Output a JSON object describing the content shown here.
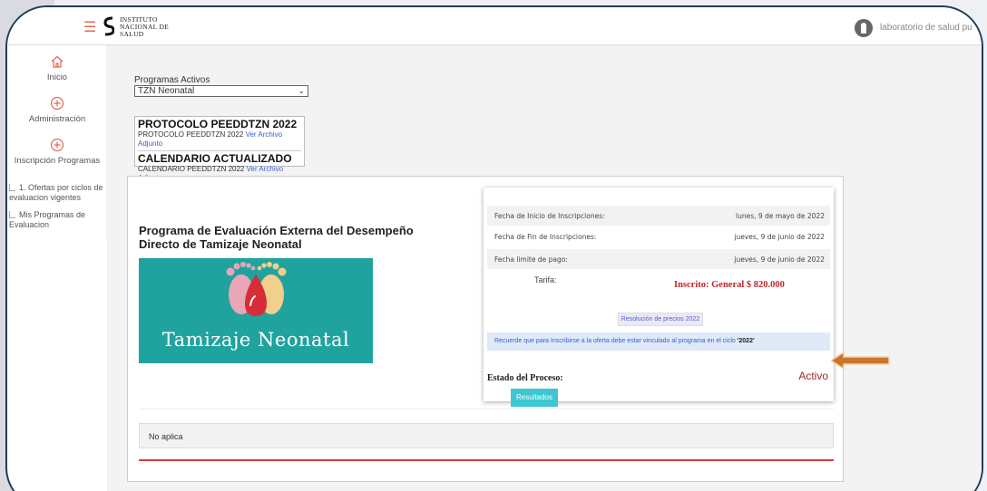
{
  "header": {
    "logo_lines": [
      "Instituto",
      "Nacional de",
      "Salud"
    ],
    "user_name": "laboratorio de salud pu"
  },
  "sidebar": {
    "items": [
      {
        "label": "Inicio",
        "icon": "home-icon"
      },
      {
        "label": "Administración",
        "icon": "plus-circle-icon"
      },
      {
        "label": "Inscripción Programas",
        "icon": "plus-circle-icon"
      }
    ],
    "subitems": [
      {
        "label": "1. Ofertas por ciclos de evaluacion vigentes"
      },
      {
        "label": "Mis Programas de Evaluacion"
      }
    ]
  },
  "programs": {
    "label": "Programas Activos",
    "selected": "TZN Neonatal"
  },
  "protocols": [
    {
      "title": "PROTOCOLO PEEDDTZN 2022",
      "line": "PROTOCOLO PEEDDTZN 2022",
      "link": "Ver Archivo Adjunto"
    },
    {
      "title": "CALENDARIO ACTUALIZADO",
      "line": "CALENDARIO PEEDDTZN 2022",
      "link": "Ver Archivo Adjunto"
    }
  ],
  "card": {
    "title": "Programa de Evaluación Externa del Desempeño Directo de Tamizaje Neonatal",
    "banner_text": "Tamizaje Neonatal",
    "rows": [
      {
        "label": "Fecha de Inicio de Inscripciones:",
        "value": "lunes, 9 de mayo de 2022"
      },
      {
        "label": "Fecha de Fin de Inscripciones:",
        "value": "jueves, 9 de junio de 2022"
      },
      {
        "label": "Fecha limite de pago:",
        "value": "jueves, 9 de junio de 2022"
      }
    ],
    "tarifa_label": "Tarifa:",
    "tarifa_value": "Inscrito: General $ 820.000",
    "resolucion_button": "Resolución de precios 2022",
    "notice_text": "Recuerde que para Inscribirse a la oferta debe estar vinculado al programa en el ciclo",
    "notice_year": "'2022'",
    "estado_label": "Estado del Proceso:",
    "estado_value": "Activo",
    "results_button": "Resultados",
    "no_aplica": "No aplica"
  },
  "colors": {
    "accent": "#3ec6d2",
    "tarifa": "#c0272d",
    "estado": "#9b2c1f",
    "arrow": "#c8772a",
    "banner": "#20a39e"
  }
}
